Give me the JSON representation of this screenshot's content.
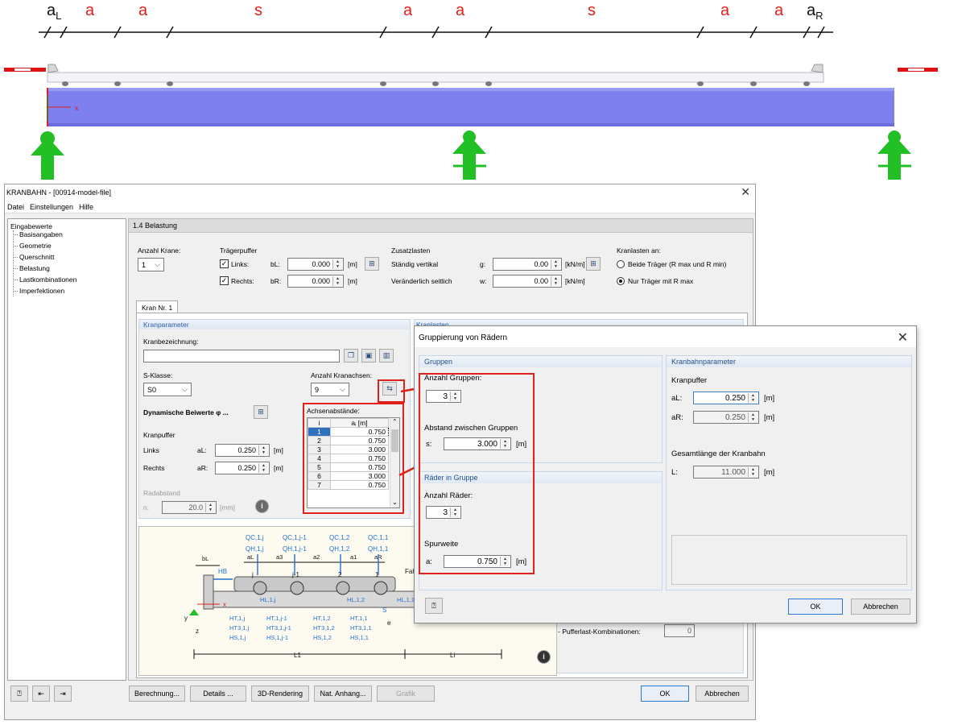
{
  "drawing": {
    "labels": [
      "a",
      "a",
      "a",
      "s",
      "a",
      "a",
      "s",
      "a",
      "a",
      "a"
    ],
    "label_subs": [
      "L",
      "",
      "",
      "",
      "",
      "",
      "",
      "",
      "",
      "R"
    ],
    "axis_x": "x"
  },
  "main": {
    "title": "KRANBAHN - [00914-model-file]",
    "menu": [
      "Datei",
      "Einstellungen",
      "Hilfe"
    ],
    "tree": {
      "root": "Eingabewerte",
      "items": [
        "Basisangaben",
        "Geometrie",
        "Querschnitt",
        "Belastung",
        "Lastkombinationen",
        "Imperfektionen"
      ]
    },
    "section": "1.4  Belastung",
    "anzahl_krane": {
      "label": "Anzahl Krane:",
      "value": "1"
    },
    "traegerpuffer": {
      "label": "Trägerpuffer",
      "links": {
        "label": "Links:",
        "sym": "bL:",
        "value": "0.000",
        "unit": "[m]"
      },
      "rechts": {
        "label": "Rechts:",
        "sym": "bR:",
        "value": "0.000",
        "unit": "[m]"
      }
    },
    "zusatzlasten": {
      "label": "Zusatzlasten",
      "g": {
        "label": "Ständig vertikal",
        "sym": "g:",
        "value": "0.00",
        "unit": "[kN/m]"
      },
      "w": {
        "label": "Veränderlich seitlich",
        "sym": "w:",
        "value": "0.00",
        "unit": "[kN/m]"
      }
    },
    "kranlasten": {
      "label": "Kranlasten an:",
      "opt1": "Beide Träger (R max und R min)",
      "opt2": "Nur Träger mit R max"
    },
    "tab": "Kran Nr. 1",
    "kranparameter": {
      "head": "Kranparameter",
      "bezeichnung_label": "Kranbezeichnung:",
      "bezeichnung_value": "",
      "sklasse_label": "S-Klasse:",
      "sklasse_value": "S0",
      "achsen_label": "Anzahl Kranachsen:",
      "achsen_value": "9",
      "dyn_label": "Dynamische Beiwerte φ ...",
      "kranpuffer_label": "Kranpuffer",
      "links": {
        "label": "Links",
        "sym": "aL:",
        "value": "0.250",
        "unit": "[m]"
      },
      "rechts": {
        "label": "Rechts",
        "sym": "aR:",
        "value": "0.250",
        "unit": "[m]"
      },
      "radabstand_label": "Radabstand",
      "radabstand": {
        "sym": "n:",
        "value": "20.0",
        "unit": "[mm]"
      }
    },
    "achsenabstaende": {
      "label": "Achsenabstände:",
      "col_i": "i",
      "col_a": "aᵢ [m]",
      "rows": [
        {
          "i": "1",
          "a": "0.750"
        },
        {
          "i": "2",
          "a": "0.750"
        },
        {
          "i": "3",
          "a": "3.000"
        },
        {
          "i": "4",
          "a": "0.750"
        },
        {
          "i": "5",
          "a": "0.750"
        },
        {
          "i": "6",
          "a": "3.000"
        },
        {
          "i": "7",
          "a": "0.750"
        }
      ]
    },
    "kranlasten_panel": {
      "head": "Kranlasten",
      "puffer_label": "- Pufferlast-Kombinationen:",
      "puffer_value": "0"
    },
    "diagram": {
      "loads_top": [
        "QC,1,j",
        "QC,1,j-1",
        "QC,1,2",
        "QC,1,1"
      ],
      "loads_h": [
        "QH,1,j",
        "QH,1,j-1",
        "QH,1,2",
        "QH,1,1"
      ],
      "dims": [
        "bL",
        "aL",
        "a3",
        "a2",
        "a1",
        "aR"
      ],
      "wheels": [
        "j",
        "j-1",
        "2",
        "1"
      ],
      "hb": "HB",
      "hl": [
        "HL,1,j",
        "HL,1,2",
        "HL,1,1"
      ],
      "fahrt": "Fahr",
      "bottom_t": [
        "HT,1,j",
        "HT,1,j-1",
        "HT,1,2",
        "HT,1,1"
      ],
      "bottom_t3": [
        "HT3,1,j",
        "HT3,1,j-1",
        "HT3,1,2",
        "HT3,1,1"
      ],
      "bottom_s": [
        "HS,1,j",
        "HS,1,j-1",
        "HS,1,2",
        "HS,1,1"
      ],
      "spans": [
        "L1",
        "Li"
      ],
      "axes": [
        "x",
        "y",
        "z"
      ],
      "misc": [
        "S",
        "e"
      ]
    },
    "buttons": {
      "berechnung": "Berechnung...",
      "details": "Details ...",
      "rendering": "3D-Rendering",
      "anhang": "Nat. Anhang...",
      "grafik": "Grafik",
      "ok": "OK",
      "abbrechen": "Abbrechen"
    }
  },
  "dialog": {
    "title": "Gruppierung von Rädern",
    "gruppen": {
      "head": "Gruppen",
      "anzahl_label": "Anzahl Gruppen:",
      "anzahl_value": "3",
      "abstand_label": "Abstand zwischen Gruppen",
      "abstand": {
        "sym": "s:",
        "value": "3.000",
        "unit": "[m]"
      }
    },
    "raeder": {
      "head": "Räder in Gruppe",
      "anzahl_label": "Anzahl Räder:",
      "anzahl_value": "3",
      "spurweite_label": "Spurweite",
      "spurweite": {
        "sym": "a:",
        "value": "0.750",
        "unit": "[m]"
      }
    },
    "kranbahn": {
      "head": "Kranbahnparameter",
      "kranpuffer_label": "Kranpuffer",
      "aL": {
        "sym": "aL:",
        "value": "0.250",
        "unit": "[m]"
      },
      "aR": {
        "sym": "aR:",
        "value": "0.250",
        "unit": "[m]"
      },
      "gesamt_label": "Gesamtlänge der Kranbahn",
      "L": {
        "sym": "L:",
        "value": "11.000",
        "unit": "[m]"
      }
    },
    "buttons": {
      "ok": "OK",
      "abbrechen": "Abbrechen"
    }
  },
  "colors": {
    "beam": "#7f80f0",
    "support": "#22c024",
    "dim_red": "#e0201a",
    "accent": "#2b78d4"
  }
}
